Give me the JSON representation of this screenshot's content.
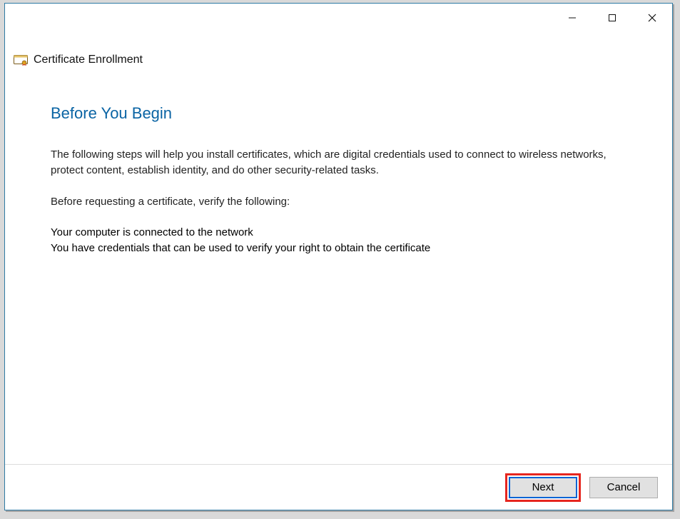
{
  "window": {
    "title": "Certificate Enrollment"
  },
  "icons": {
    "cert": "certificate-enrollment-icon"
  },
  "content": {
    "heading": "Before You Begin",
    "paragraph1": "The following steps will help you install certificates, which are digital credentials used to connect to wireless networks, protect content, establish identity, and do other security-related tasks.",
    "paragraph2": "Before requesting a certificate, verify the following:",
    "bullet1": "Your computer is connected to the network",
    "bullet2": "You have credentials that can be used to verify your right to obtain the certificate"
  },
  "buttons": {
    "next": "Next",
    "cancel": "Cancel"
  },
  "colors": {
    "accent": "#0a64a4",
    "highlight": "#e6261f",
    "window_border": "#2e7aa4"
  }
}
